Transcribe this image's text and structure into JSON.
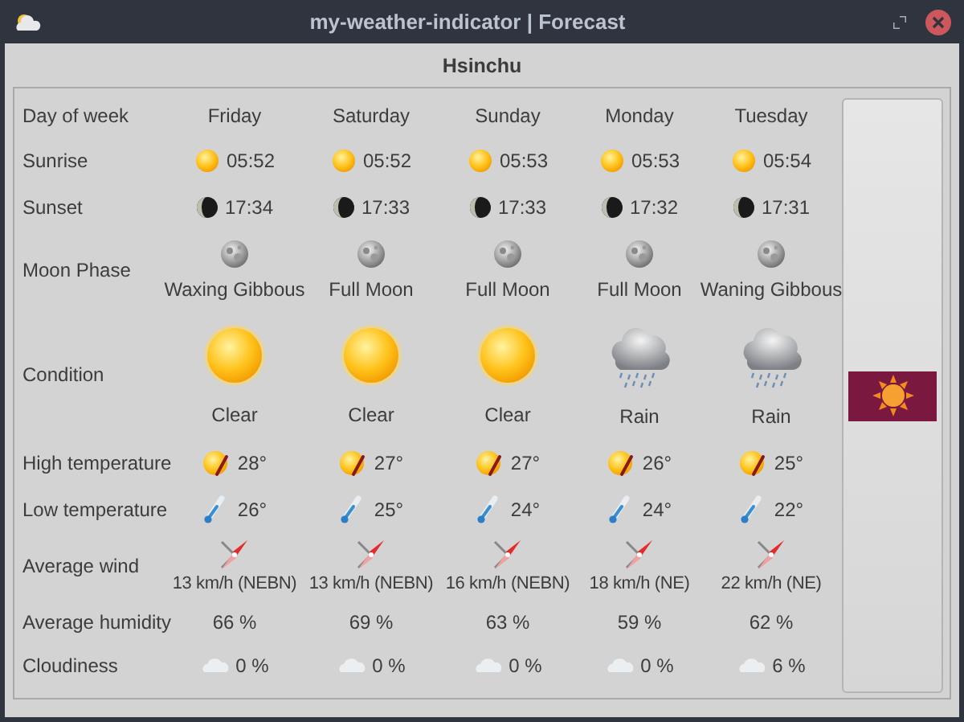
{
  "window": {
    "title": "my-weather-indicator | Forecast"
  },
  "location": "Hsinchu",
  "row_labels": [
    "Day of week",
    "Sunrise",
    "Sunset",
    "Moon Phase",
    "Condition",
    "High temperature",
    "Low temperature",
    "Average wind",
    "Average humidity",
    "Cloudiness"
  ],
  "days": [
    {
      "name": "Friday",
      "sunrise": "05:52",
      "sunset": "17:34",
      "moon_phase": "Waxing Gibbous",
      "condition": {
        "kind": "clear",
        "text": "Clear"
      },
      "high": "28°",
      "low": "26°",
      "wind": "13 km/h (NEBN)",
      "humidity": "66 %",
      "cloudiness": "0 %"
    },
    {
      "name": "Saturday",
      "sunrise": "05:52",
      "sunset": "17:33",
      "moon_phase": "Full Moon",
      "condition": {
        "kind": "clear",
        "text": "Clear"
      },
      "high": "27°",
      "low": "25°",
      "wind": "13 km/h (NEBN)",
      "humidity": "69 %",
      "cloudiness": "0 %"
    },
    {
      "name": "Sunday",
      "sunrise": "05:53",
      "sunset": "17:33",
      "moon_phase": "Full Moon",
      "condition": {
        "kind": "clear",
        "text": "Clear"
      },
      "high": "27°",
      "low": "24°",
      "wind": "16 km/h (NEBN)",
      "humidity": "63 %",
      "cloudiness": "0 %"
    },
    {
      "name": "Monday",
      "sunrise": "05:53",
      "sunset": "17:32",
      "moon_phase": "Full Moon",
      "condition": {
        "kind": "rain",
        "text": "Rain"
      },
      "high": "26°",
      "low": "24°",
      "wind": "18 km/h (NE)",
      "humidity": "59 %",
      "cloudiness": "0 %"
    },
    {
      "name": "Tuesday",
      "sunrise": "05:54",
      "sunset": "17:31",
      "moon_phase": "Waning Gibbous",
      "condition": {
        "kind": "rain",
        "text": "Rain"
      },
      "high": "25°",
      "low": "22°",
      "wind": "22 km/h (NE)",
      "humidity": "62 %",
      "cloudiness": "6 %"
    }
  ]
}
